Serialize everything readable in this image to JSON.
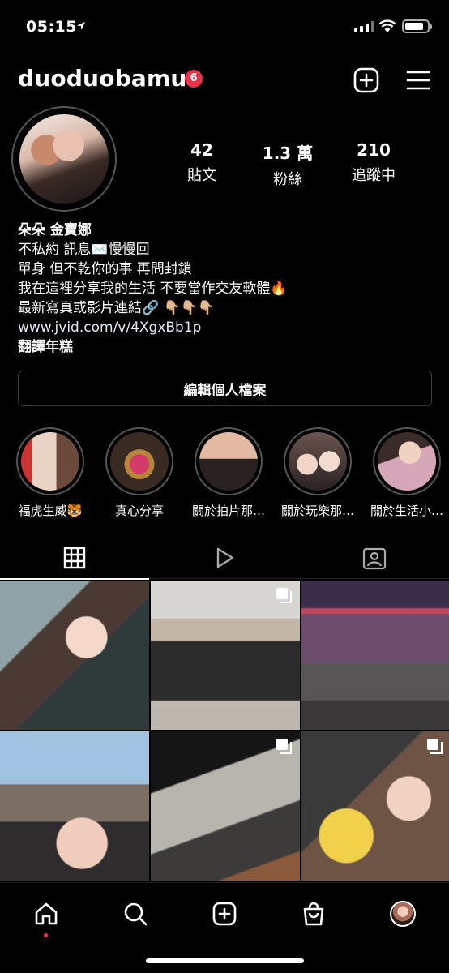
{
  "status_bar": {
    "time": "05:15"
  },
  "header": {
    "username": "duoduobamu",
    "notification_count": "6"
  },
  "profile": {
    "stats": [
      {
        "value": "42",
        "label": "貼文"
      },
      {
        "value": "1.3 萬",
        "label": "粉絲"
      },
      {
        "value": "210",
        "label": "追蹤中"
      }
    ],
    "bio": {
      "name": "朵朵 金寶娜",
      "lines": [
        "不私約 訊息✉️慢慢回",
        "單身 但不乾你的事 再問封鎖",
        "我在這裡分享我的生活 不要當作交友軟體🔥",
        "最新寫真或影片連結🔗 👇🏼👇🏼👇🏼"
      ],
      "link": "www.jvid.com/v/4XgxBb1p",
      "translate": "翻譯年糕"
    },
    "edit_button": "編輯個人檔案"
  },
  "highlights": [
    {
      "label": "福虎生威🐯"
    },
    {
      "label": "真心分享"
    },
    {
      "label": "關於拍片那…"
    },
    {
      "label": "關於玩樂那…"
    },
    {
      "label": "關於生活小…"
    }
  ],
  "tabs": [
    "grid",
    "reels",
    "tagged"
  ],
  "colors": {
    "accent_red": "#e8334a",
    "background": "#000000"
  }
}
